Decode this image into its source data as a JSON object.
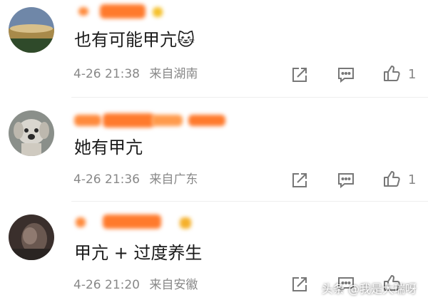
{
  "comments": [
    {
      "text": "也有可能甲亢🐱",
      "date": "4-26",
      "time": "21:38",
      "location": "来自湖南",
      "likes": "1"
    },
    {
      "text": "她有甲亢",
      "date": "4-26",
      "time": "21:36",
      "location": "来自广东",
      "likes": "1"
    },
    {
      "text": "甲亢 + 过度养生",
      "date": "4-26",
      "time": "21:20",
      "location": "来自安徽",
      "likes": ""
    }
  ],
  "watermark": "头条 @我是大瑞呀",
  "colors": {
    "name_blur": "#ff8a3c",
    "meta_gray": "#888888",
    "icon_gray": "#777777"
  },
  "icons": {
    "share": "share-icon",
    "comment": "comment-icon",
    "like": "thumbs-up-icon"
  }
}
